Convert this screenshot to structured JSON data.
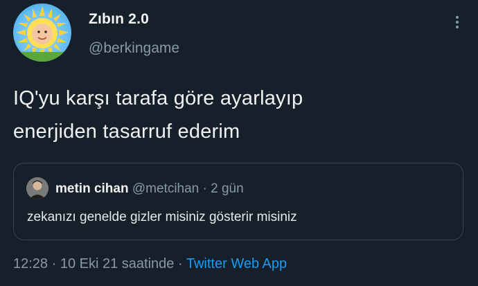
{
  "author": {
    "name": "Zıbın 2.0",
    "handle": "@berkingame"
  },
  "tweet": {
    "line1": "IQ'yu karşı tarafa göre ayarlayıp",
    "line2": "enerjiden tasarruf ederim"
  },
  "quoted": {
    "name": "metin cihan",
    "handle": "@metcihan",
    "separator": "·",
    "time": "2 gün",
    "text": "zekanızı genelde gizler misiniz gösterir misiniz"
  },
  "meta": {
    "time": "12:28",
    "dot1": "·",
    "date": "10 Eki 21 saatinde",
    "dot2": "·",
    "source": "Twitter Web App"
  },
  "icons": {
    "more": "more-vertical-icon",
    "avatar": "sun-baby-avatar",
    "quote_avatar": "user-photo-avatar"
  },
  "colors": {
    "background": "#15202b",
    "secondary_text": "#8b98a5",
    "link": "#1d9bf0",
    "border": "#38444d"
  }
}
